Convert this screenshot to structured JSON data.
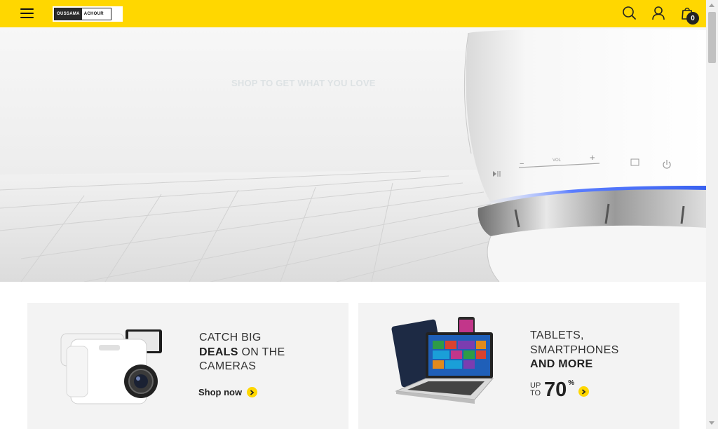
{
  "header": {
    "logo": {
      "part1": "OUSSAMA",
      "part2": "ACHOUR"
    },
    "cart_count": "0",
    "icons": [
      "menu-icon",
      "search-icon",
      "user-icon",
      "shopping-bag-icon"
    ]
  },
  "hero": {
    "tagline": "SHOP TO GET WHAT YOU LOVE",
    "speaker_labels": {
      "vol": "VOL",
      "minus": "−",
      "plus": "+"
    }
  },
  "promos": [
    {
      "line1": "CATCH BIG",
      "line2_bold": "DEALS",
      "line2_rest": " ON THE",
      "line3": "CAMERAS",
      "link": "Shop now"
    },
    {
      "line1": "TABLETS,",
      "line2": "SMARTPHONES",
      "line3_bold": "AND MORE",
      "upto_1": "UP",
      "upto_2": "TO",
      "percent_value": "70",
      "percent_sign": "%"
    }
  ],
  "colors": {
    "accent": "#ffd700",
    "dark": "#222222",
    "card_bg": "#f3f3f3"
  }
}
